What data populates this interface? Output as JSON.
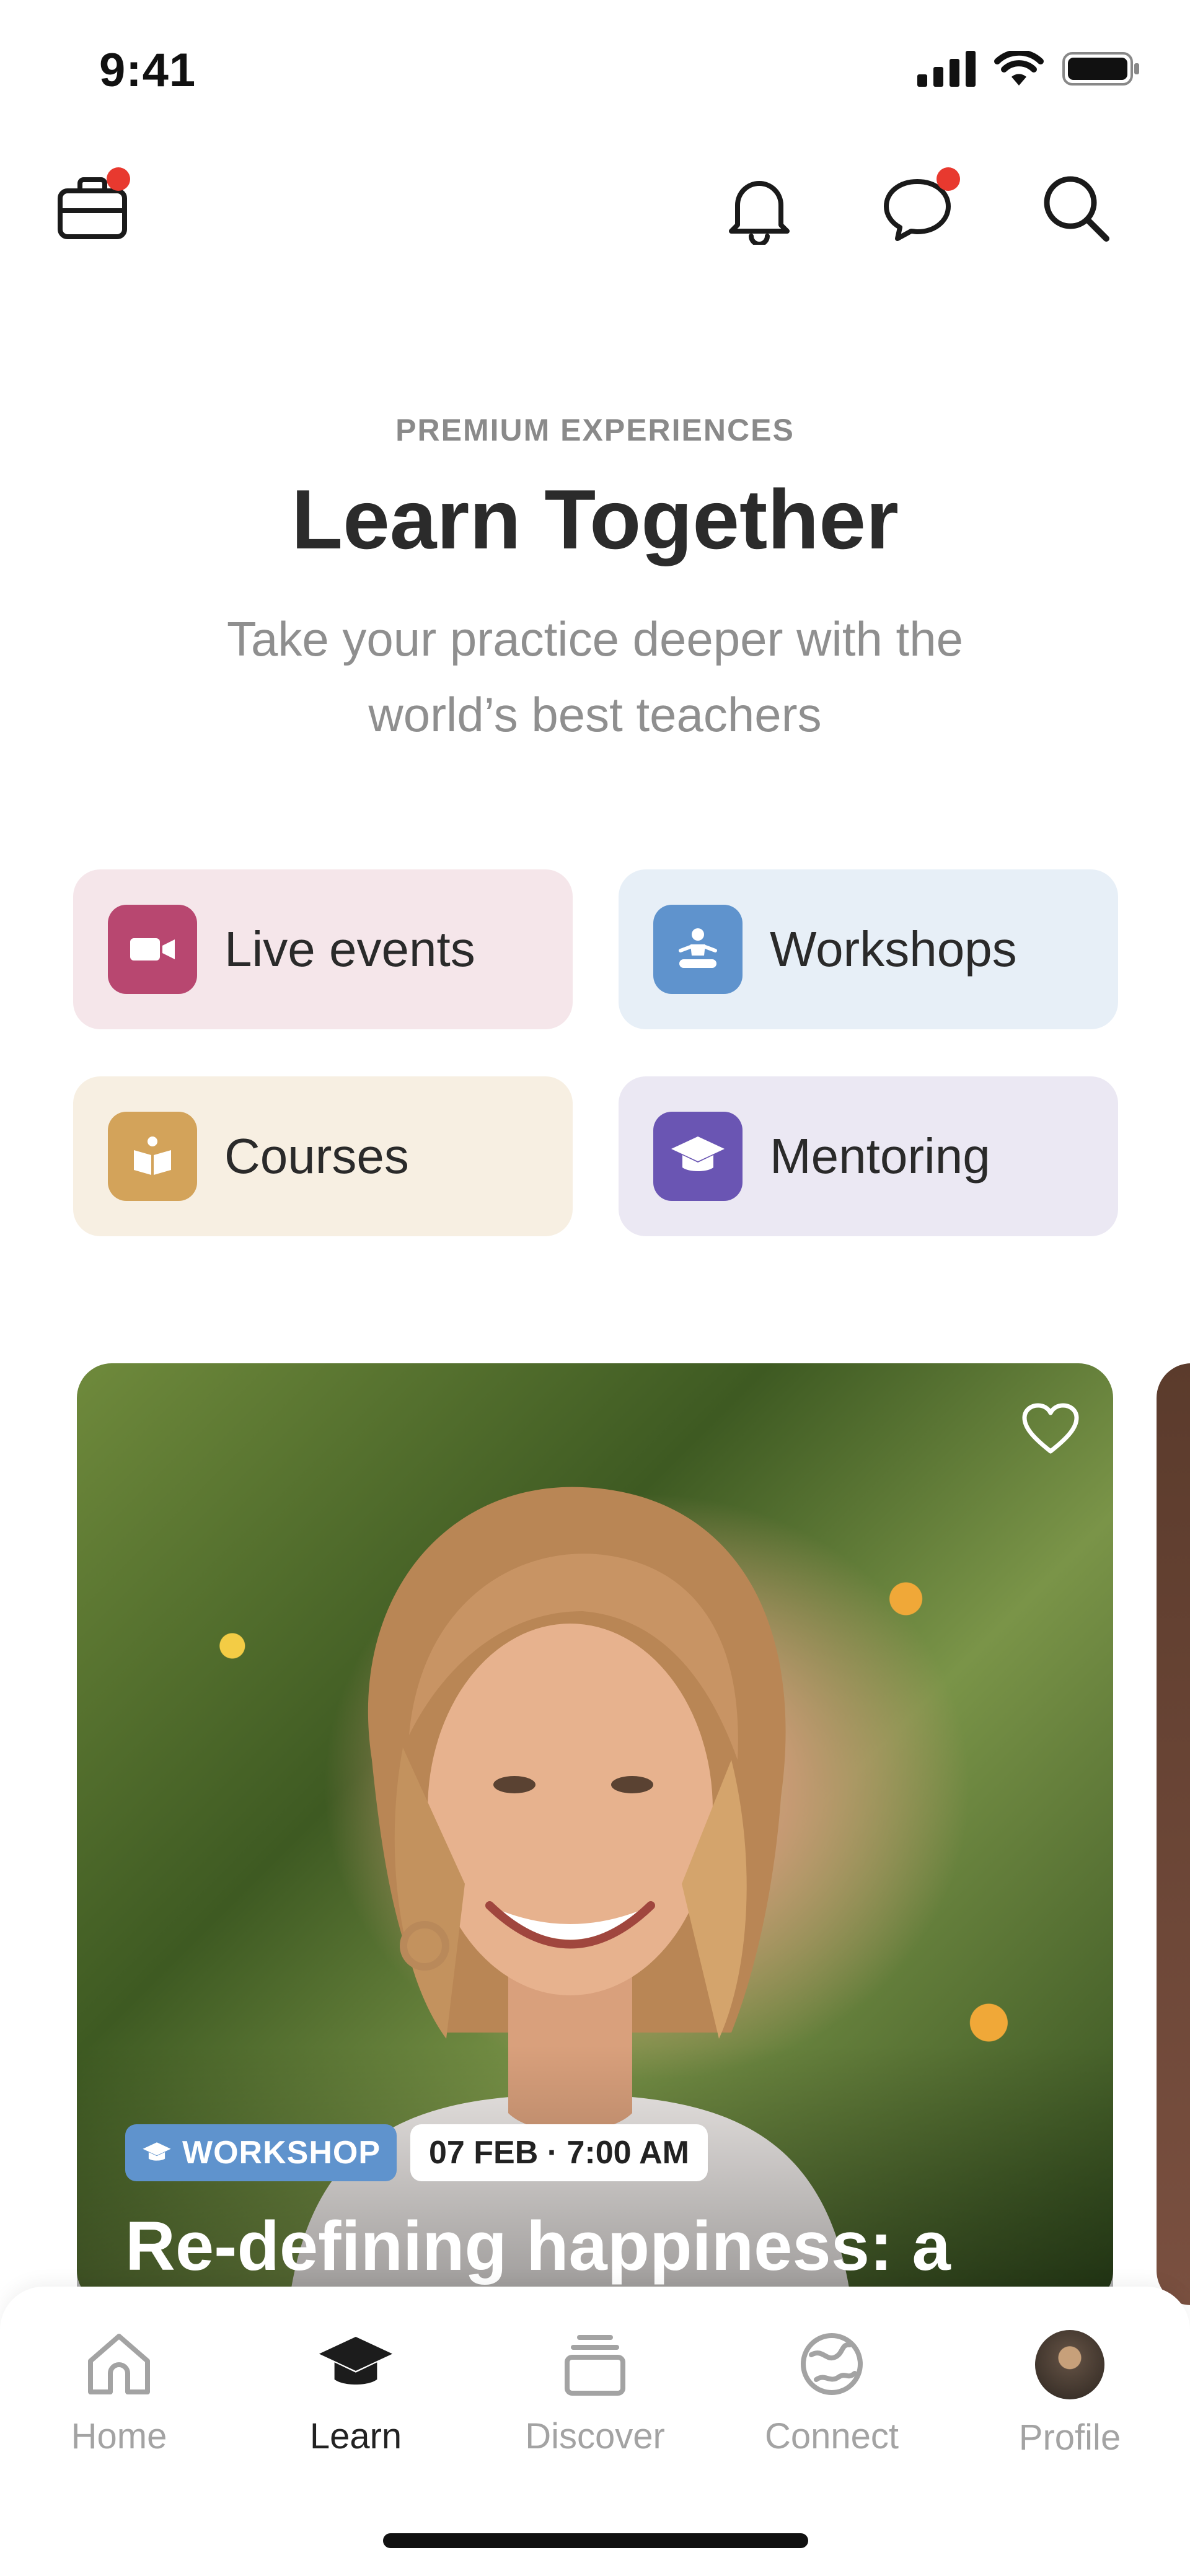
{
  "status_bar": {
    "time": "9:41"
  },
  "top_bar": {
    "icons": [
      "briefcase-icon",
      "bell-icon",
      "chat-icon",
      "search-icon"
    ],
    "notification_color": "#e8392f"
  },
  "hero": {
    "eyebrow": "PREMIUM EXPERIENCES",
    "title": "Learn Together",
    "subtitle_line1": "Take your practice deeper with the",
    "subtitle_line2": "world’s best teachers"
  },
  "categories": [
    {
      "label": "Live events",
      "icon": "video-camera-icon",
      "bg": "#f5e6ea",
      "icon_bg": "#b84770"
    },
    {
      "label": "Workshops",
      "icon": "meditation-icon",
      "bg": "#e7eff7",
      "icon_bg": "#5f93cd"
    },
    {
      "label": "Courses",
      "icon": "book-icon",
      "bg": "#f7efe2",
      "icon_bg": "#d3a35a"
    },
    {
      "label": "Mentoring",
      "icon": "graduation-cap-icon",
      "bg": "#ebe8f3",
      "icon_bg": "#6a55b3"
    }
  ],
  "feature_card": {
    "type_badge": "WORKSHOP",
    "date_badge": "07 FEB · 7:00 AM",
    "title": "Re-defining happiness: a",
    "favorite_icon": "heart-icon"
  },
  "tab_bar": {
    "tabs": [
      {
        "label": "Home",
        "icon": "home-icon",
        "active": false
      },
      {
        "label": "Learn",
        "icon": "graduation-cap-icon",
        "active": true
      },
      {
        "label": "Discover",
        "icon": "stack-icon",
        "active": false
      },
      {
        "label": "Connect",
        "icon": "globe-icon",
        "active": false
      },
      {
        "label": "Profile",
        "icon": "avatar",
        "active": false
      }
    ]
  }
}
